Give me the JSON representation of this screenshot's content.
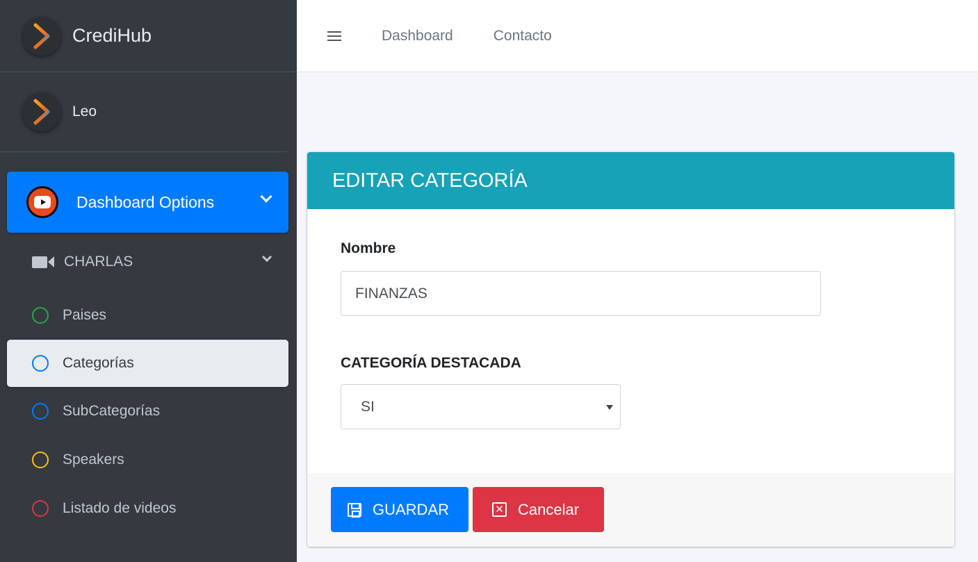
{
  "brand": {
    "name": "CrediHub"
  },
  "user": {
    "name": "Leo"
  },
  "sidebar": {
    "dashboard_label": "Dashboard Options",
    "group_label": "CHARLAS",
    "items": [
      {
        "label": "Paises",
        "color": "#28a745"
      },
      {
        "label": "Categorías",
        "color": "#007bff",
        "active": true
      },
      {
        "label": "SubCategorías",
        "color": "#007bff"
      },
      {
        "label": "Speakers",
        "color": "#ffc107"
      },
      {
        "label": "Listado de videos",
        "color": "#dc3545"
      }
    ]
  },
  "topnav": {
    "links": [
      "Dashboard",
      "Contacto"
    ]
  },
  "card": {
    "title": "EDITAR CATEGORÍA",
    "name_label": "Nombre",
    "name_value": "FINANZAS",
    "featured_label": "CATEGORÍA DESTACADA",
    "featured_value": "SI",
    "save_label": "GUARDAR",
    "cancel_label": "Cancelar"
  },
  "colors": {
    "primary": "#007bff",
    "info": "#17a2b8",
    "danger": "#dc3545",
    "sidebar": "#343a40"
  },
  "icons": [
    "logo-chevron-icon",
    "youtube-icon",
    "video-camera-icon",
    "circle-icon",
    "hamburger-icon",
    "save-icon",
    "close-box-icon",
    "chevron-down-icon"
  ]
}
